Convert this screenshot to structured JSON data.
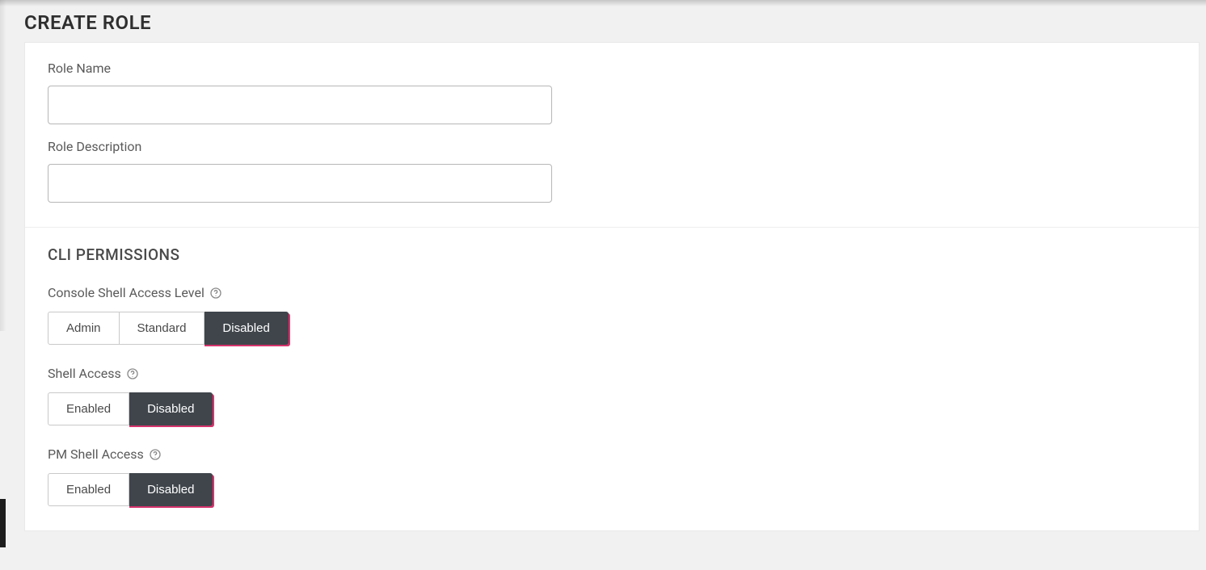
{
  "page": {
    "title": "CREATE ROLE"
  },
  "form": {
    "role_name": {
      "label": "Role Name",
      "value": ""
    },
    "role_desc": {
      "label": "Role Description",
      "value": ""
    }
  },
  "cli": {
    "heading": "CLI PERMISSIONS",
    "console_shell": {
      "label": "Console Shell Access Level",
      "options": {
        "admin": "Admin",
        "standard": "Standard",
        "disabled": "Disabled"
      },
      "selected": "disabled"
    },
    "shell_access": {
      "label": "Shell Access",
      "options": {
        "enabled": "Enabled",
        "disabled": "Disabled"
      },
      "selected": "disabled"
    },
    "pm_shell": {
      "label": "PM Shell Access",
      "options": {
        "enabled": "Enabled",
        "disabled": "Disabled"
      },
      "selected": "disabled"
    }
  }
}
